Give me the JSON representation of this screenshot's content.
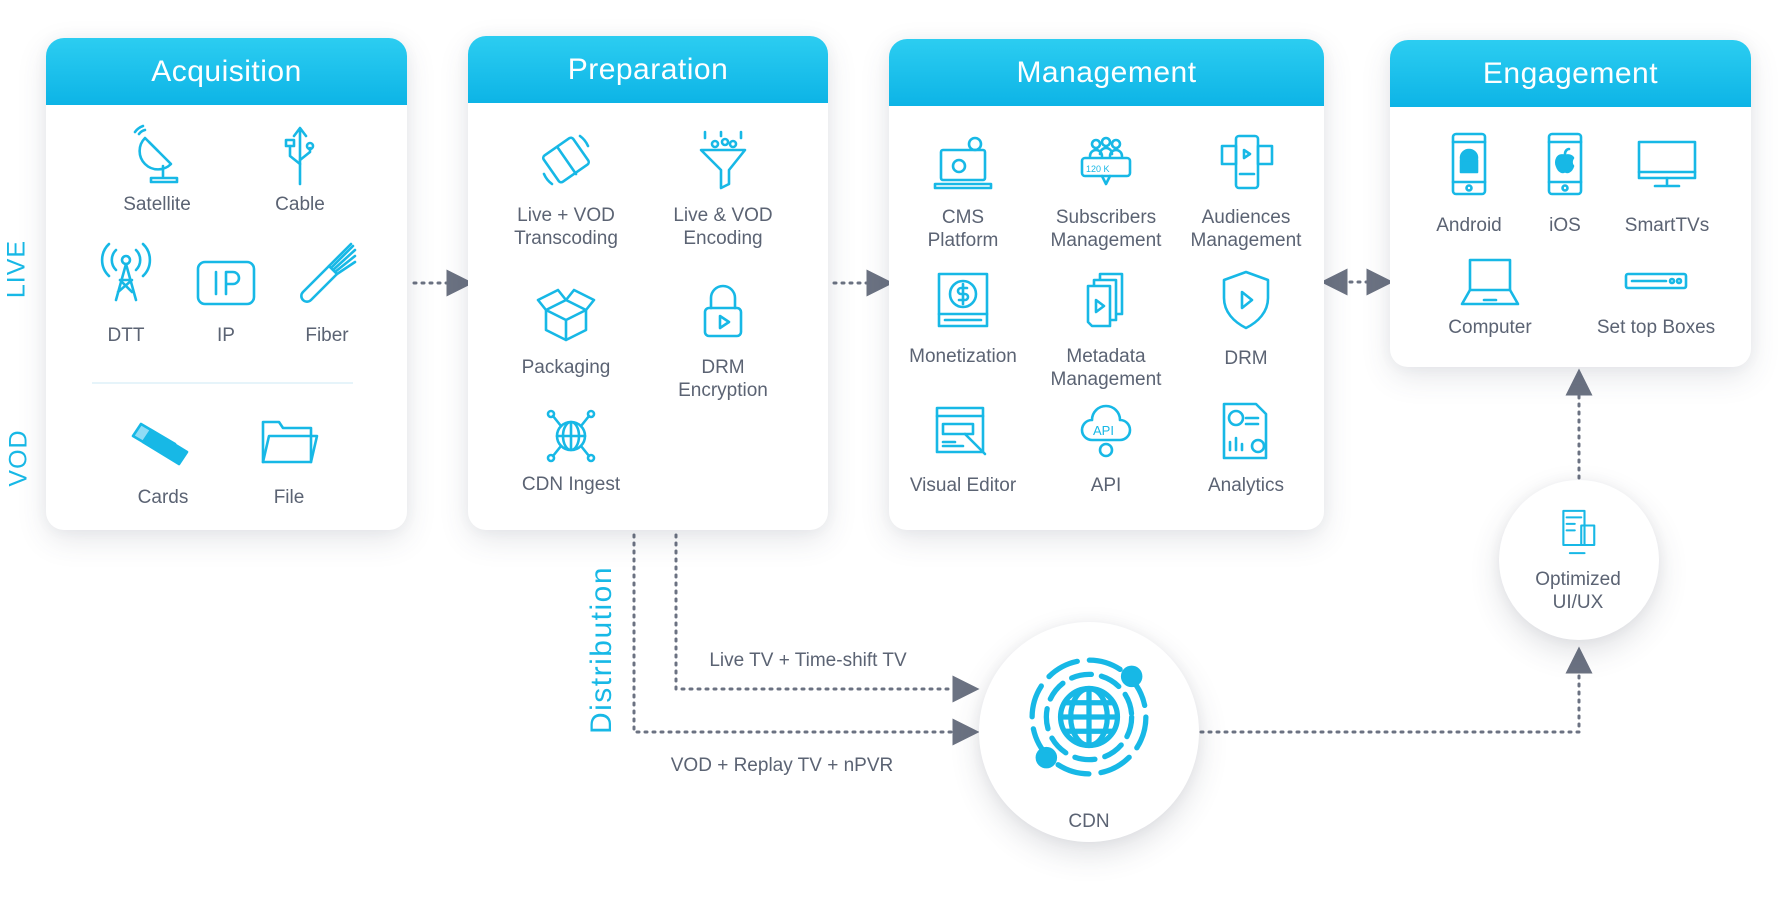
{
  "colors": {
    "accent": "#17b8e6",
    "header_top": "#2ccdf1",
    "header_bottom": "#0db4e6",
    "text": "#5b6373",
    "connector": "#6b7282"
  },
  "side_labels": {
    "live": "LIVE",
    "vod": "VOD",
    "distribution": "Distribution"
  },
  "stages": {
    "acquisition": {
      "title": "Acquisition",
      "items": [
        {
          "label": "Satellite",
          "icon": "satellite-dish-icon"
        },
        {
          "label": "Cable",
          "icon": "usb-cable-icon"
        },
        {
          "label": "DTT",
          "icon": "broadcast-tower-icon"
        },
        {
          "label": "IP",
          "icon": "ip-icon"
        },
        {
          "label": "Fiber",
          "icon": "fiber-optic-icon"
        },
        {
          "label": "Cards",
          "icon": "cards-icon"
        },
        {
          "label": "File",
          "icon": "folder-icon"
        }
      ]
    },
    "preparation": {
      "title": "Preparation",
      "items": [
        {
          "label": "Live + VOD\nTranscoding",
          "icon": "film-strip-icon"
        },
        {
          "label": "Live & VOD\nEncoding",
          "icon": "funnel-icon"
        },
        {
          "label": "Packaging",
          "icon": "box-icon"
        },
        {
          "label": "DRM\nEncryption",
          "icon": "lock-play-icon"
        },
        {
          "label": "CDN Ingest",
          "icon": "globe-network-icon"
        }
      ]
    },
    "management": {
      "title": "Management",
      "items": [
        {
          "label": "CMS\nPlatform",
          "icon": "laptop-gear-icon"
        },
        {
          "label": "Subscribers\nManagement",
          "icon": "subscribers-icon"
        },
        {
          "label": "Audiences\nManagement",
          "icon": "audience-phone-icon"
        },
        {
          "label": "Monetization",
          "icon": "dollar-screen-icon"
        },
        {
          "label": "Metadata\nManagement",
          "icon": "documents-play-icon"
        },
        {
          "label": "DRM",
          "icon": "shield-play-icon"
        },
        {
          "label": "Visual Editor",
          "icon": "browser-brush-icon"
        },
        {
          "label": "API",
          "icon": "api-cloud-icon"
        },
        {
          "label": "Analytics",
          "icon": "analytics-report-icon"
        }
      ]
    },
    "engagement": {
      "title": "Engagement",
      "items": [
        {
          "label": "Android",
          "icon": "android-phone-icon"
        },
        {
          "label": "iOS",
          "icon": "apple-phone-icon"
        },
        {
          "label": "SmartTVs",
          "icon": "tv-icon"
        },
        {
          "label": "Computer",
          "icon": "laptop-icon"
        },
        {
          "label": "Set top Boxes",
          "icon": "set-top-box-icon"
        }
      ]
    }
  },
  "subscriber_badge": "120 K",
  "distribution": {
    "live_path": "Live TV + Time-shift TV",
    "vod_path": "VOD + Replay TV + nPVR",
    "cdn": {
      "label": "CDN",
      "icon": "cdn-globe-icon"
    },
    "ui": {
      "label": "Optimized\nUI/UX",
      "icon": "ui-screens-icon"
    }
  }
}
